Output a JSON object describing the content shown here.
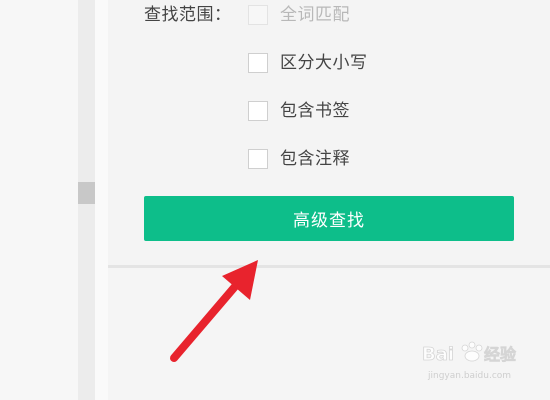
{
  "search_options": {
    "scope_label": "查找范围：",
    "options": [
      {
        "label": "全词匹配",
        "checked": false,
        "disabled": true
      },
      {
        "label": "区分大小写",
        "checked": false,
        "disabled": false
      },
      {
        "label": "包含书签",
        "checked": false,
        "disabled": false
      },
      {
        "label": "包含注释",
        "checked": false,
        "disabled": false
      }
    ],
    "advanced_button_label": "高级查找"
  },
  "annotation": {
    "arrow_color": "#e8232d"
  },
  "watermark": {
    "brand": "Bai度 经验",
    "url": "jingyan.baidu.com"
  },
  "colors": {
    "accent": "#0dbe8a"
  }
}
